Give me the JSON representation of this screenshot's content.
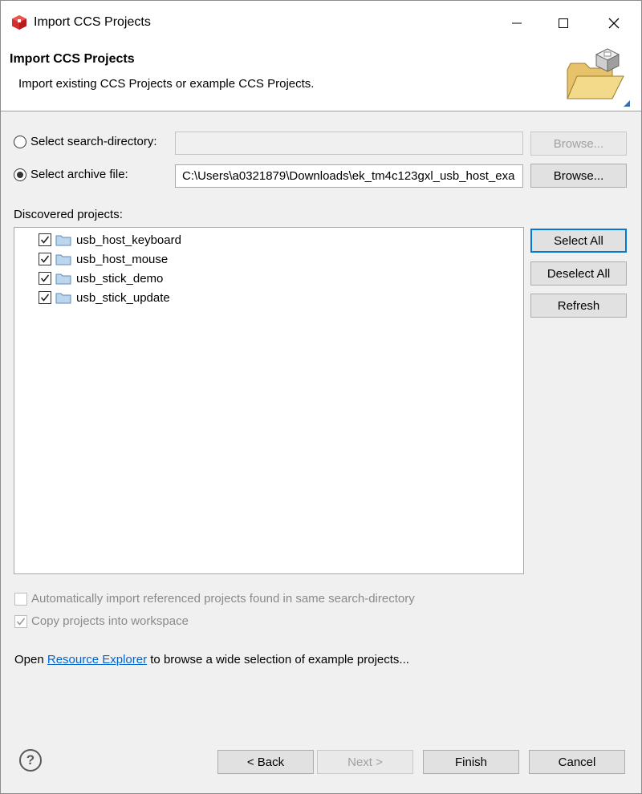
{
  "window": {
    "title": "Import CCS Projects"
  },
  "banner": {
    "title": "Import CCS Projects",
    "description": "Import existing CCS Projects or example CCS Projects."
  },
  "source": {
    "search_directory_label": "Select search-directory:",
    "search_directory_value": "",
    "archive_file_label": "Select archive file:",
    "archive_file_value": "C:\\Users\\a0321879\\Downloads\\ek_tm4c123gxl_usb_host_exa",
    "selected": "archive",
    "browse_label": "Browse..."
  },
  "discovered": {
    "label": "Discovered projects:",
    "projects": [
      {
        "name": "usb_host_keyboard",
        "checked": true
      },
      {
        "name": "usb_host_mouse",
        "checked": true
      },
      {
        "name": "usb_stick_demo",
        "checked": true
      },
      {
        "name": "usb_stick_update",
        "checked": true
      }
    ],
    "select_all_label": "Select All",
    "deselect_all_label": "Deselect All",
    "refresh_label": "Refresh"
  },
  "options": {
    "auto_import_label": "Automatically import referenced projects found in same search-directory",
    "auto_import_checked": false,
    "copy_label": "Copy projects into workspace",
    "copy_checked": true
  },
  "footer_text": {
    "prefix": "Open ",
    "link": "Resource Explorer",
    "suffix": " to browse a wide selection of example projects..."
  },
  "buttons": {
    "help": "?",
    "back": "< Back",
    "next": "Next >",
    "finish": "Finish",
    "cancel": "Cancel"
  },
  "colors": {
    "accent": "#0078d7",
    "link": "#0066cc",
    "app_icon": "#d32f2f"
  }
}
